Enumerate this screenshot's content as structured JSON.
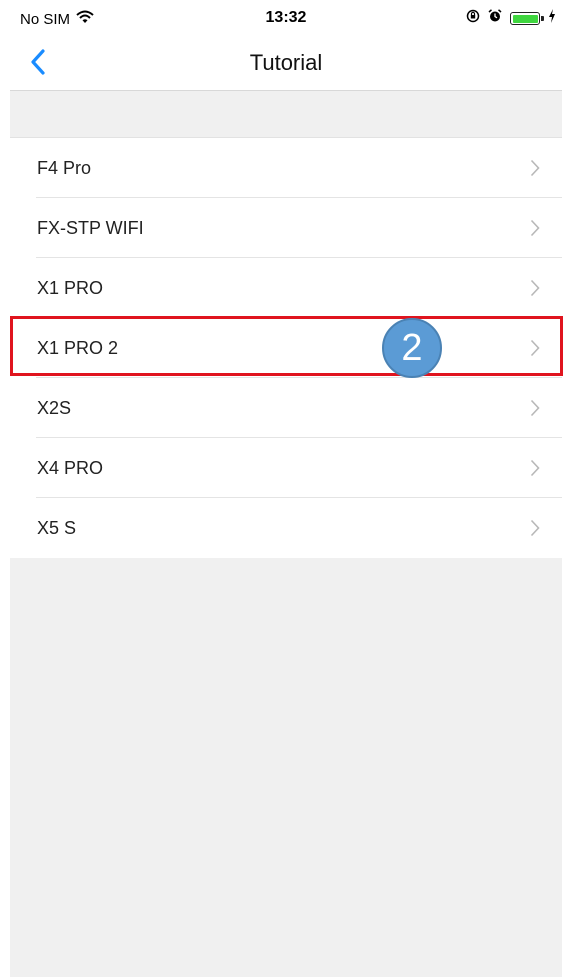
{
  "status_bar": {
    "carrier": "No SIM",
    "time": "13:32",
    "battery_level": 1.0,
    "battery_color": "#3fd63f",
    "icons": [
      "wifi-icon",
      "rotation-lock-icon",
      "alarm-icon",
      "battery-icon",
      "charging-bolt-icon"
    ]
  },
  "nav": {
    "back_icon": "chevron-left-icon",
    "title": "Tutorial",
    "accent_color": "#1a8cff"
  },
  "list": {
    "items": [
      {
        "label": "F4 Pro"
      },
      {
        "label": "FX-STP WIFI"
      },
      {
        "label": "X1 PRO"
      },
      {
        "label": "X1 PRO 2"
      },
      {
        "label": "X2S"
      },
      {
        "label": "X4 PRO"
      },
      {
        "label": "X5 S"
      }
    ]
  },
  "annotation": {
    "step_number": "2",
    "highlight_color": "#e0141e",
    "badge_color": "#5b9bd5"
  }
}
